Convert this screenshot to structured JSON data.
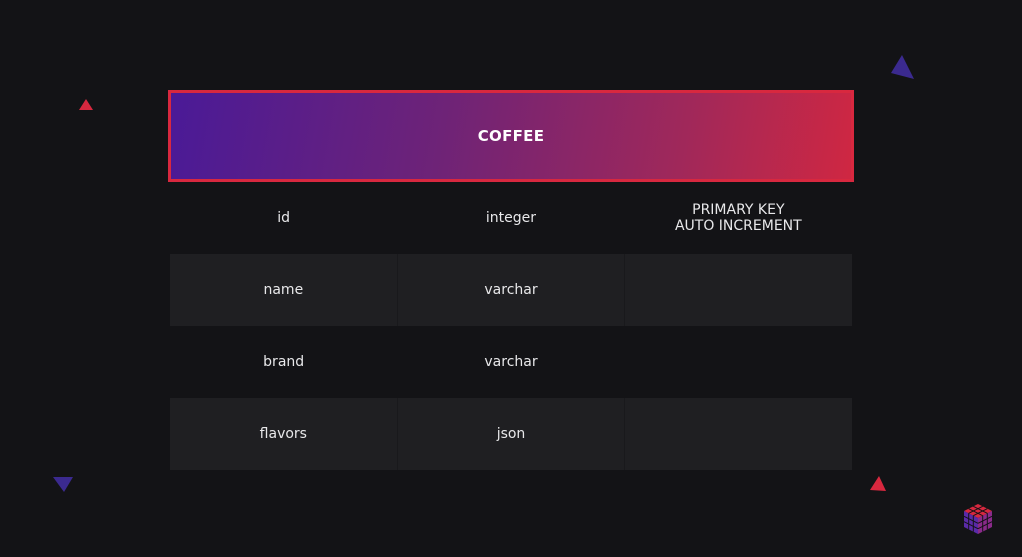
{
  "table": {
    "title": "COFFEE",
    "rows": [
      {
        "column": "id",
        "type": "integer",
        "constraints": "PRIMARY KEY\nAUTO INCREMENT"
      },
      {
        "column": "name",
        "type": "varchar",
        "constraints": ""
      },
      {
        "column": "brand",
        "type": "varchar",
        "constraints": ""
      },
      {
        "column": "flavors",
        "type": "json",
        "constraints": ""
      }
    ]
  },
  "colors": {
    "background": "#131316",
    "header_gradient_start": "#4a1a97",
    "header_gradient_end": "#cf2742",
    "header_border": "#d8283f",
    "row_shade": "#1f1f22",
    "accent_red": "#d8283f",
    "accent_purple": "#3b2a8f"
  },
  "decorations": {
    "icons": [
      "triangle-red-icon",
      "triangle-purple-icon",
      "cube-logo-icon"
    ]
  }
}
